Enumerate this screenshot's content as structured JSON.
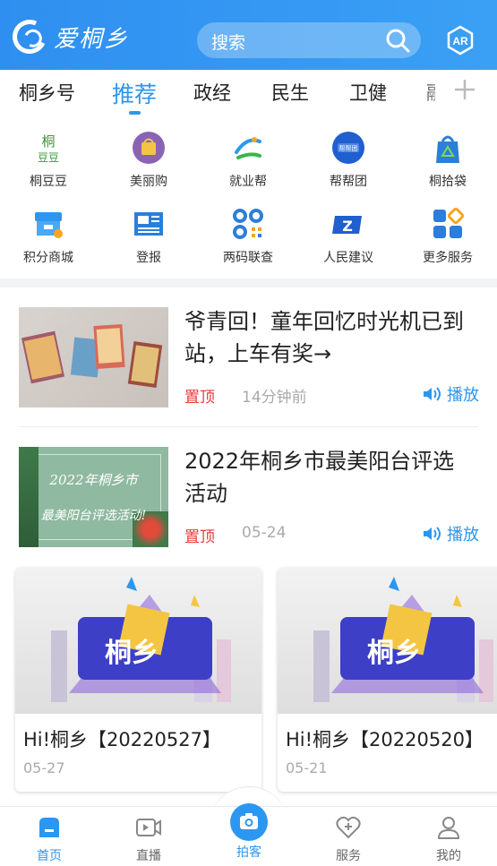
{
  "header": {
    "logo_text": "爱桐乡",
    "search_placeholder": "搜索",
    "ar_label": "AR"
  },
  "tabs": [
    {
      "label": "桐乡号"
    },
    {
      "label": "推荐",
      "active": true
    },
    {
      "label": "政经"
    },
    {
      "label": "民生"
    },
    {
      "label": "卫健"
    },
    {
      "label": "融"
    }
  ],
  "services": [
    {
      "label": "桐豆豆",
      "icon": "tongdoudou-icon"
    },
    {
      "label": "美丽购",
      "icon": "meiligou-icon"
    },
    {
      "label": "就业帮",
      "icon": "jiuyebang-icon"
    },
    {
      "label": "帮帮团",
      "icon": "bangbangtuan-icon"
    },
    {
      "label": "桐拾袋",
      "icon": "tongshidai-icon"
    },
    {
      "label": "积分商城",
      "icon": "store-icon"
    },
    {
      "label": "登报",
      "icon": "newspaper-icon"
    },
    {
      "label": "两码联查",
      "icon": "qrcode-icon"
    },
    {
      "label": "人民建议",
      "icon": "suggestion-icon"
    },
    {
      "label": "更多服务",
      "icon": "more-services-icon"
    }
  ],
  "news": [
    {
      "title": "爷青回！童年回忆时光机已到站，上车有奖→",
      "tag": "置顶",
      "time": "14分钟前",
      "play": "播放"
    },
    {
      "title": "2022年桐乡市最美阳台评选活动",
      "tag": "置顶",
      "time": "05-24",
      "play": "播放",
      "thumb_text_1": "2022年桐乡市",
      "thumb_text_2": "最美阳台评选活动!"
    }
  ],
  "videos": [
    {
      "title": "Hi!桐乡【20220527】",
      "date": "05-27",
      "thumb_text": "桐乡"
    },
    {
      "title": "Hi!桐乡【20220520】",
      "date": "05-21",
      "thumb_text": "桐乡"
    }
  ],
  "bottom_nav": [
    {
      "label": "首页",
      "icon": "home-icon",
      "active": true
    },
    {
      "label": "直播",
      "icon": "live-icon"
    },
    {
      "label": "拍客",
      "icon": "camera-icon"
    },
    {
      "label": "服务",
      "icon": "service-heart-icon"
    },
    {
      "label": "我的",
      "icon": "profile-icon"
    }
  ],
  "colors": {
    "accent": "#2b97f0",
    "header_bg": "#3aa0f5",
    "tag_red": "#e83a3a"
  }
}
